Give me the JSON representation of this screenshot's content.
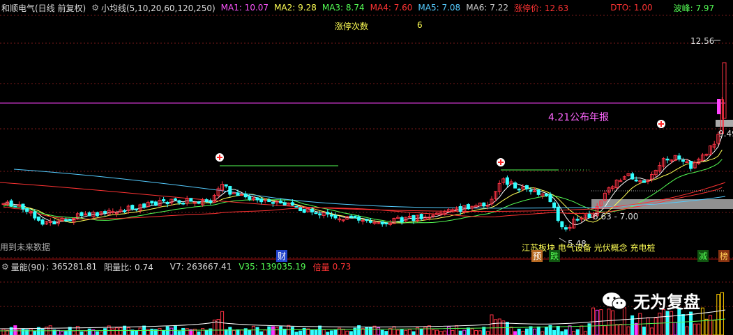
{
  "header": {
    "stock_title": "和顺电气(日线 前复权)",
    "indicator_name": "小均线(5,10,20,60,120,250)",
    "ma": [
      {
        "label": "MA1: 10.07",
        "color": "#ff55ff"
      },
      {
        "label": "MA2: 9.28",
        "color": "#ffff55"
      },
      {
        "label": "MA3: 8.74",
        "color": "#55ff55"
      },
      {
        "label": "MA4: 7.60",
        "color": "#ff3333"
      },
      {
        "label": "MA5: 7.08",
        "color": "#55ccff"
      },
      {
        "label": "MA6: 7.22",
        "color": "#cccccc"
      }
    ],
    "limit_price": "涨停价: 12.63",
    "dto": "DTO: 1.00",
    "wave_peak": "波峰: 7.97"
  },
  "main_chart": {
    "limit_count_label": "涨停次数",
    "limit_count_value": "6",
    "price_high_label": "12.56",
    "price_right_label": "9.49",
    "announcement": "4.21公布年报",
    "range_label": "6.63 - 7.00",
    "low_label": "5.48",
    "future_data_note": "用到未来数据",
    "cai_marker": "财",
    "yu_marker": "预",
    "die_marker": "跌",
    "jian_marker": "减",
    "bang_marker": "榜",
    "concepts": "江苏板块 电气设备 光伏概念 充电桩"
  },
  "volume_header": {
    "name": "量能(90)",
    "value": ": 365281.81",
    "yang_ratio": "阳量比: 0.74",
    "v7": "V7: 263667.41",
    "v35": "V35: 139035.19",
    "bei_liang_label": "倍量",
    "bei_liang_value": "0.73"
  },
  "watermark": {
    "text": "无为复盘",
    "icon": "wechat-icon"
  },
  "colors": {
    "up": "#ff3344",
    "down": "#33ffff",
    "ma5": "#ffffff",
    "ma10": "#ffff55",
    "ma20": "#55ff55",
    "ma60": "#ff3333",
    "ma120": "#55ccff",
    "limit_line": "#ff44ff",
    "volume_magenta": "#ff33ff"
  }
}
